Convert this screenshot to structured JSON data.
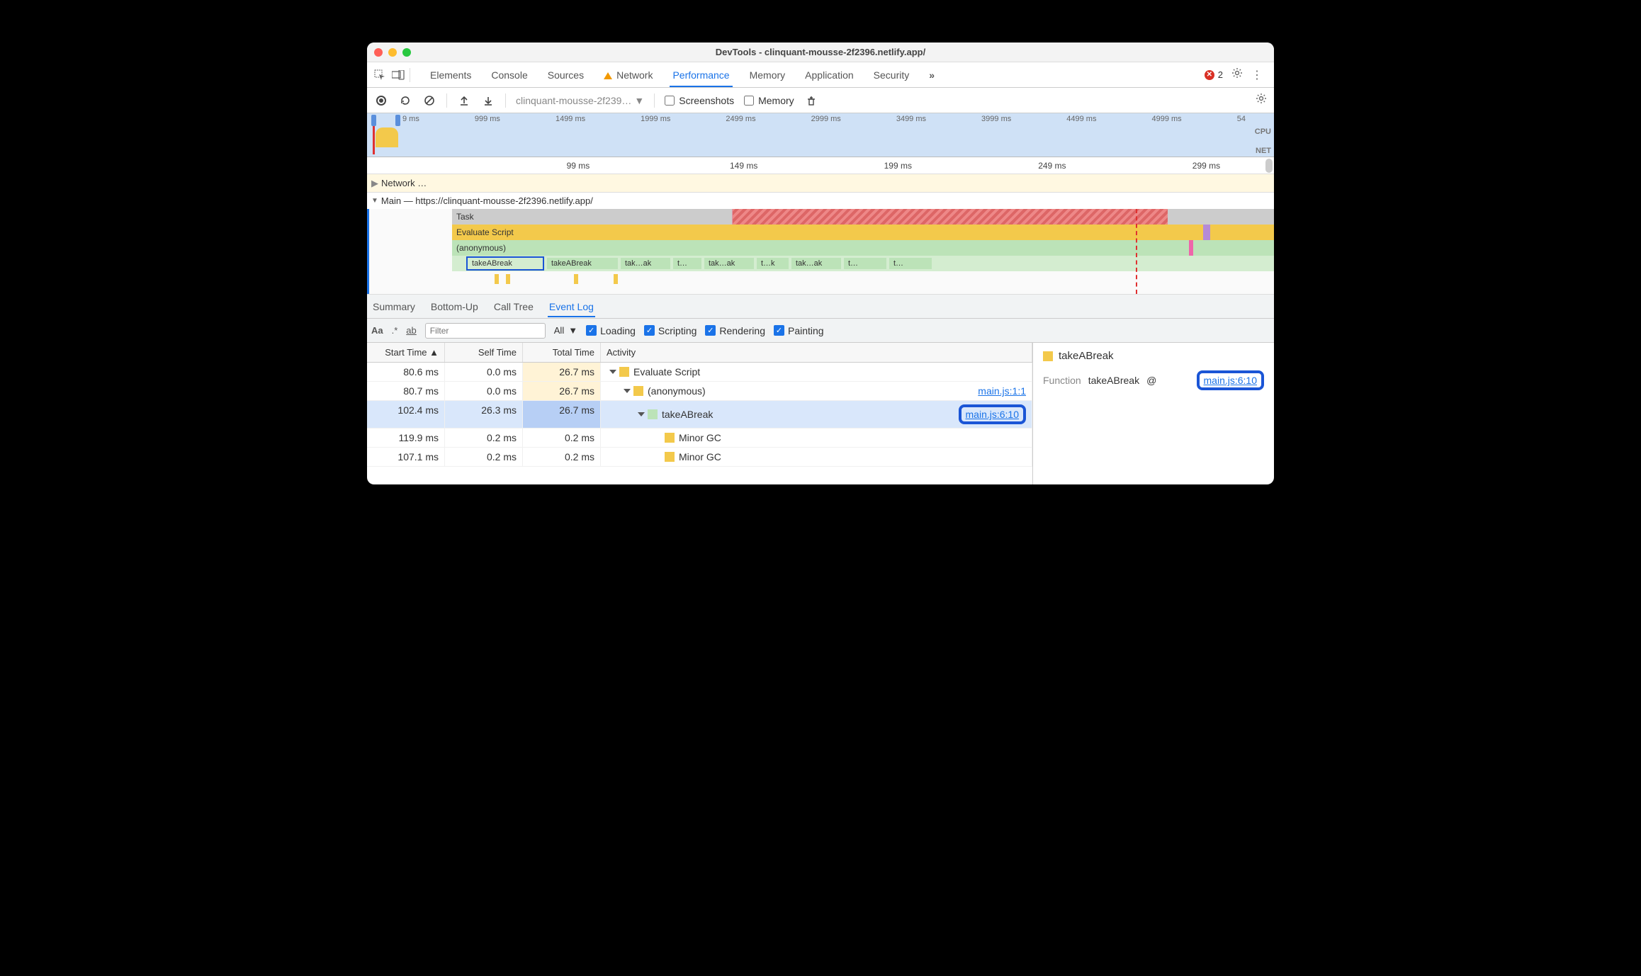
{
  "window": {
    "title": "DevTools - clinquant-mousse-2f2396.netlify.app/"
  },
  "tabs": {
    "elements": "Elements",
    "console": "Console",
    "sources": "Sources",
    "network": "Network",
    "performance": "Performance",
    "memory": "Memory",
    "application": "Application",
    "security": "Security",
    "more": "»"
  },
  "errors": {
    "count": "2"
  },
  "toolbar": {
    "profile_selector": "clinquant-mousse-2f239…",
    "screenshots": "Screenshots",
    "memory": "Memory"
  },
  "overview": {
    "ticks": [
      "9 ms",
      "999 ms",
      "1499 ms",
      "1999 ms",
      "2499 ms",
      "2999 ms",
      "3499 ms",
      "3999 ms",
      "4499 ms",
      "4999 ms",
      "54"
    ],
    "cpu": "CPU",
    "net": "NET"
  },
  "ruler": {
    "ticks": [
      "99 ms",
      "149 ms",
      "199 ms",
      "249 ms",
      "299 ms"
    ]
  },
  "network_track": "Network …",
  "main_track": {
    "label": "Main — https://clinquant-mousse-2f2396.netlify.app/",
    "rows": {
      "task": "Task",
      "evaluate": "Evaluate Script",
      "anonymous": "(anonymous)",
      "calls": [
        "takeABreak",
        "takeABreak",
        "tak…ak",
        "t…",
        "tak…ak",
        "t…k",
        "tak…ak",
        "t…",
        "t…"
      ]
    }
  },
  "detail_tabs": {
    "summary": "Summary",
    "bottomup": "Bottom-Up",
    "calltree": "Call Tree",
    "eventlog": "Event Log"
  },
  "filter": {
    "placeholder": "Filter",
    "all": "All",
    "loading": "Loading",
    "scripting": "Scripting",
    "rendering": "Rendering",
    "painting": "Painting"
  },
  "columns": {
    "start": "Start Time",
    "self": "Self Time",
    "total": "Total Time",
    "activity": "Activity"
  },
  "rows": [
    {
      "start": "80.6 ms",
      "self": "0.0 ms",
      "total": "26.7 ms",
      "indent": 0,
      "swatch": "yellow",
      "disc": "down",
      "activity": "Evaluate Script",
      "link": "",
      "tot_class": "tot-hl"
    },
    {
      "start": "80.7 ms",
      "self": "0.0 ms",
      "total": "26.7 ms",
      "indent": 1,
      "swatch": "yellow",
      "disc": "down",
      "activity": "(anonymous)",
      "link": "main.js:1:1",
      "tot_class": "tot-hl"
    },
    {
      "start": "102.4 ms",
      "self": "26.3 ms",
      "total": "26.7 ms",
      "indent": 2,
      "swatch": "green",
      "disc": "down",
      "activity": "takeABreak",
      "link": "main.js:6:10",
      "tot_class": "tot-sel",
      "selected": true,
      "link_boxed": true
    },
    {
      "start": "119.9 ms",
      "self": "0.2 ms",
      "total": "0.2 ms",
      "indent": 3,
      "swatch": "yellow",
      "disc": "",
      "activity": "Minor GC",
      "link": "",
      "tot_class": ""
    },
    {
      "start": "107.1 ms",
      "self": "0.2 ms",
      "total": "0.2 ms",
      "indent": 3,
      "swatch": "yellow",
      "disc": "",
      "activity": "Minor GC",
      "link": "",
      "tot_class": ""
    }
  ],
  "side": {
    "title": "takeABreak",
    "fn_label": "Function",
    "fn_name": "takeABreak",
    "at": "@",
    "link": "main.js:6:10"
  }
}
